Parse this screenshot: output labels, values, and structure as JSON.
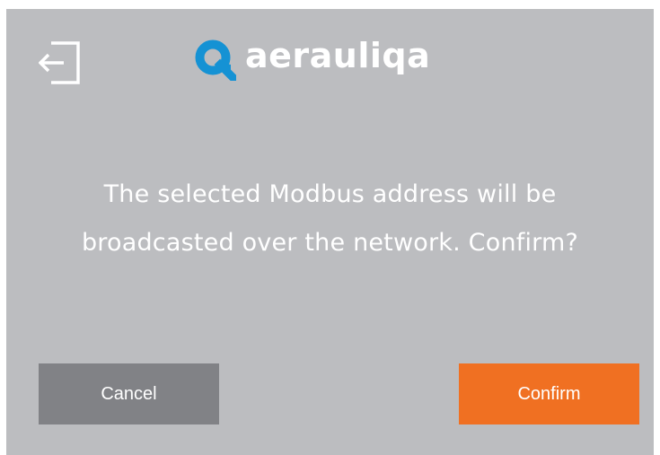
{
  "header": {
    "logout_icon": "logout-icon",
    "logo_text": "aerauliqa"
  },
  "dialog": {
    "message_line1": "The selected Modbus address will be",
    "message_line2": "broadcasted over the network. Confirm?"
  },
  "buttons": {
    "cancel_label": "Cancel",
    "confirm_label": "Confirm"
  },
  "colors": {
    "background": "#bcbdc0",
    "cancel_button": "#818286",
    "confirm_button": "#f07022",
    "logo_accent": "#1592d4",
    "text": "#ffffff"
  }
}
